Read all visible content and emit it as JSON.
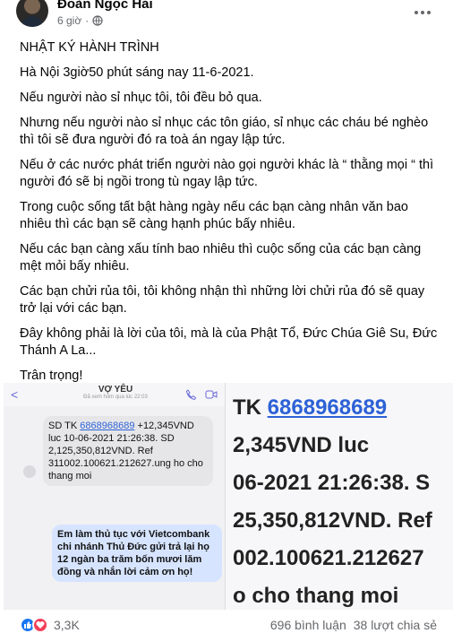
{
  "post": {
    "author": "Đoàn Ngọc Hải",
    "time": "6 giờ",
    "paragraphs": [
      "NHẬT KÝ HÀNH TRÌNH",
      "Hà Nội 3giờ50 phút sáng nay 11-6-2021.",
      "Nếu người nào sỉ nhục tôi, tôi đều bỏ qua.",
      "Nhưng nếu người nào sỉ nhục các tôn giáo, sỉ nhục các cháu bé nghèo thì tôi sẽ đưa  người đó ra toà án ngay lập tức.",
      "Nếu ở các nước phát triển người nào gọi người khác là “ thằng mọi “ thì người đó sẽ bị ngồi trong tù ngay lập tức.",
      "Trong cuộc sống tất bật hàng ngày nếu các bạn càng nhân văn bao nhiêu thì các bạn sẽ càng hạnh phúc bấy nhiêu.",
      "Nếu các bạn càng xấu tính bao nhiêu thì cuộc sống của các bạn càng mệt mỏi bấy nhiêu.",
      "Các bạn chửi rủa tôi, tôi không nhận thì những lời chửi rủa đó sẽ quay trở lại với các bạn.",
      "Đây không phải là lời của tôi, mà là của Phật Tổ, Đức Chúa Giê Su, Đức Thánh A La...",
      "Trân trọng!"
    ]
  },
  "image": {
    "contact_name": "VỢ YÊU",
    "contact_sub": "Đã xem hôm qua lúc 22:03",
    "sms_prefix": "SD TK ",
    "sms_account": "6868968689",
    "sms_rest": "+12,345VND luc 10-06-2021 21:26:38. SD 2,125,350,812VND. Ref 311002.100621.212627.ung ho cho thang moi",
    "reply": "Em làm thủ tục với Vietcombank chi nhánh Thủ Đức gửi trả lại họ 12 ngàn ba trăm bốn mươi lăm đồng và nhắn lời cảm ơn họ!",
    "zoom_lines": [
      "TK ",
      "2,345VND luc",
      "06-2021 21:26:38. S",
      "25,350,812VND. Ref",
      "002.100621.212627",
      "o cho thang moi"
    ],
    "zoom_account": "6868968689"
  },
  "footer": {
    "reaction_count": "3,3K",
    "comments": "696 bình luận",
    "shares": "38 lượt chia sẻ"
  },
  "colors": {
    "link": "#2d62d6",
    "like": "#1877f2",
    "love": "#f33e58",
    "muted": "#65676b"
  },
  "icons": [
    "globe-icon",
    "more-icon",
    "back-icon",
    "call-icon",
    "video-icon",
    "share-icon",
    "like-icon",
    "love-icon"
  ]
}
